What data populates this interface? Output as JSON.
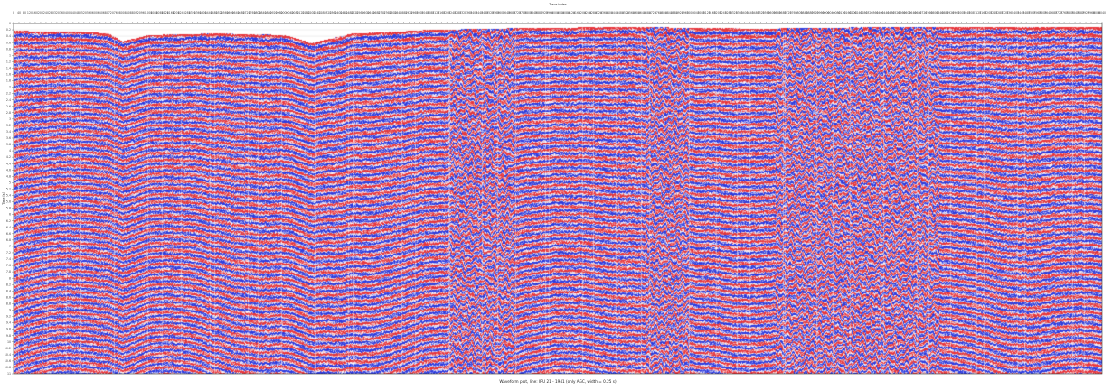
{
  "chart_data": {
    "type": "heatmap",
    "title": "",
    "subtitle": "",
    "xlabel": "Trace index",
    "ylabel": "Time [s]",
    "caption": "Waveform plot, line: IRU 21 - 1941 (only AGC, width = 0.25 s)",
    "colors": {
      "positive": "#e8343a",
      "negative": "#2b3ae0",
      "zero": "#ffffff"
    },
    "grid": true,
    "legend": "none",
    "x_tick_labels": [
      "0",
      "40",
      "80",
      "120",
      "160",
      "200",
      "240",
      "280",
      "320",
      "360",
      "400",
      "440",
      "480",
      "520",
      "560",
      "600",
      "640",
      "680",
      "720",
      "760",
      "800",
      "840",
      "880",
      "920",
      "960",
      "1000",
      "1040",
      "1080",
      "1120",
      "1160",
      "1200",
      "1240",
      "1280",
      "1320",
      "1360",
      "1400",
      "1440",
      "1480",
      "1520",
      "1560",
      "1600",
      "1640",
      "1680",
      "1720",
      "1760",
      "1800",
      "1840",
      "1880",
      "1920",
      "1960",
      "2000",
      "2040",
      "2080",
      "2120",
      "2160",
      "2200",
      "2240",
      "2280",
      "2320",
      "2360",
      "2400",
      "2440",
      "2480",
      "2520",
      "2560",
      "2600",
      "2640",
      "2680",
      "2720",
      "2760",
      "2800",
      "2840",
      "2880",
      "2920",
      "2960",
      "3000",
      "3040",
      "3080",
      "3120",
      "3160",
      "3200",
      "3240",
      "3280",
      "3320",
      "3360",
      "3400",
      "3440",
      "3480",
      "3520",
      "3560",
      "3600",
      "3640",
      "3680",
      "3720",
      "3760",
      "3800",
      "3840",
      "3880",
      "3920",
      "3960",
      "4000",
      "4040",
      "4080",
      "4120",
      "4160",
      "4200",
      "4240",
      "4280",
      "4320",
      "4360",
      "4400",
      "4440",
      "4480",
      "4520",
      "4560",
      "4600",
      "4640",
      "4680",
      "4720",
      "4760",
      "4800",
      "4840",
      "4880",
      "4920",
      "4960",
      "5000",
      "5040",
      "5080",
      "5120",
      "5160",
      "5200",
      "5240",
      "5280",
      "5320",
      "5360",
      "5400",
      "5440",
      "5480",
      "5520",
      "5560",
      "5600",
      "5640",
      "5680",
      "5720",
      "5760",
      "5800",
      "5840",
      "5880",
      "5920",
      "5960",
      "6000",
      "6040",
      "6080",
      "6120",
      "6160",
      "6200",
      "6240",
      "6280",
      "6320",
      "6360",
      "6400",
      "6440",
      "6480",
      "6520",
      "6560",
      "6600",
      "6640",
      "6680",
      "6720",
      "6760",
      "6800",
      "6840",
      "6880",
      "6920",
      "6960",
      "7000",
      "7040",
      "7080",
      "7120",
      "7160",
      "7200",
      "7240",
      "7280",
      "7320",
      "7360",
      "7400",
      "7440",
      "7480",
      "7520",
      "7560",
      "7600",
      "7640",
      "7680",
      "7720",
      "7760",
      "7800",
      "7840",
      "7880",
      "7920",
      "7960",
      "8000",
      "8040"
    ],
    "y_tick_labels": [
      "0",
      "0.2",
      "0.4",
      "0.6",
      "0.8",
      "1",
      "1.2",
      "1.4",
      "1.6",
      "1.8",
      "2",
      "2.2",
      "2.4",
      "2.6",
      "2.8",
      "3",
      "3.2",
      "3.4",
      "3.6",
      "3.8",
      "4",
      "4.2",
      "4.4",
      "4.6",
      "4.8",
      "5",
      "5.2",
      "5.4",
      "5.6",
      "5.8",
      "6",
      "6.2",
      "6.4",
      "6.6",
      "6.8",
      "7",
      "7.2",
      "7.4",
      "7.6",
      "7.8",
      "8",
      "8.2",
      "8.4",
      "8.6",
      "8.8",
      "9",
      "9.2",
      "9.4",
      "9.6",
      "9.8",
      "10",
      "10.2",
      "10.4",
      "10.6",
      "10.8",
      "11"
    ],
    "xlim": [
      0,
      8040
    ],
    "ylim": [
      11,
      0
    ],
    "seafloor_time": {
      "x": [
        0,
        500,
        700,
        800,
        1000,
        1500,
        2000,
        2200,
        2300,
        2500,
        2800,
        3000,
        3500,
        4000,
        4500,
        5000,
        5500,
        6000,
        6500,
        7000,
        7500,
        8040
      ],
      "t": [
        0.22,
        0.25,
        0.3,
        0.55,
        0.35,
        0.3,
        0.35,
        0.6,
        0.5,
        0.3,
        0.25,
        0.2,
        0.15,
        0.12,
        0.1,
        0.12,
        0.15,
        0.12,
        0.1,
        0.1,
        0.1,
        0.1
      ]
    }
  }
}
